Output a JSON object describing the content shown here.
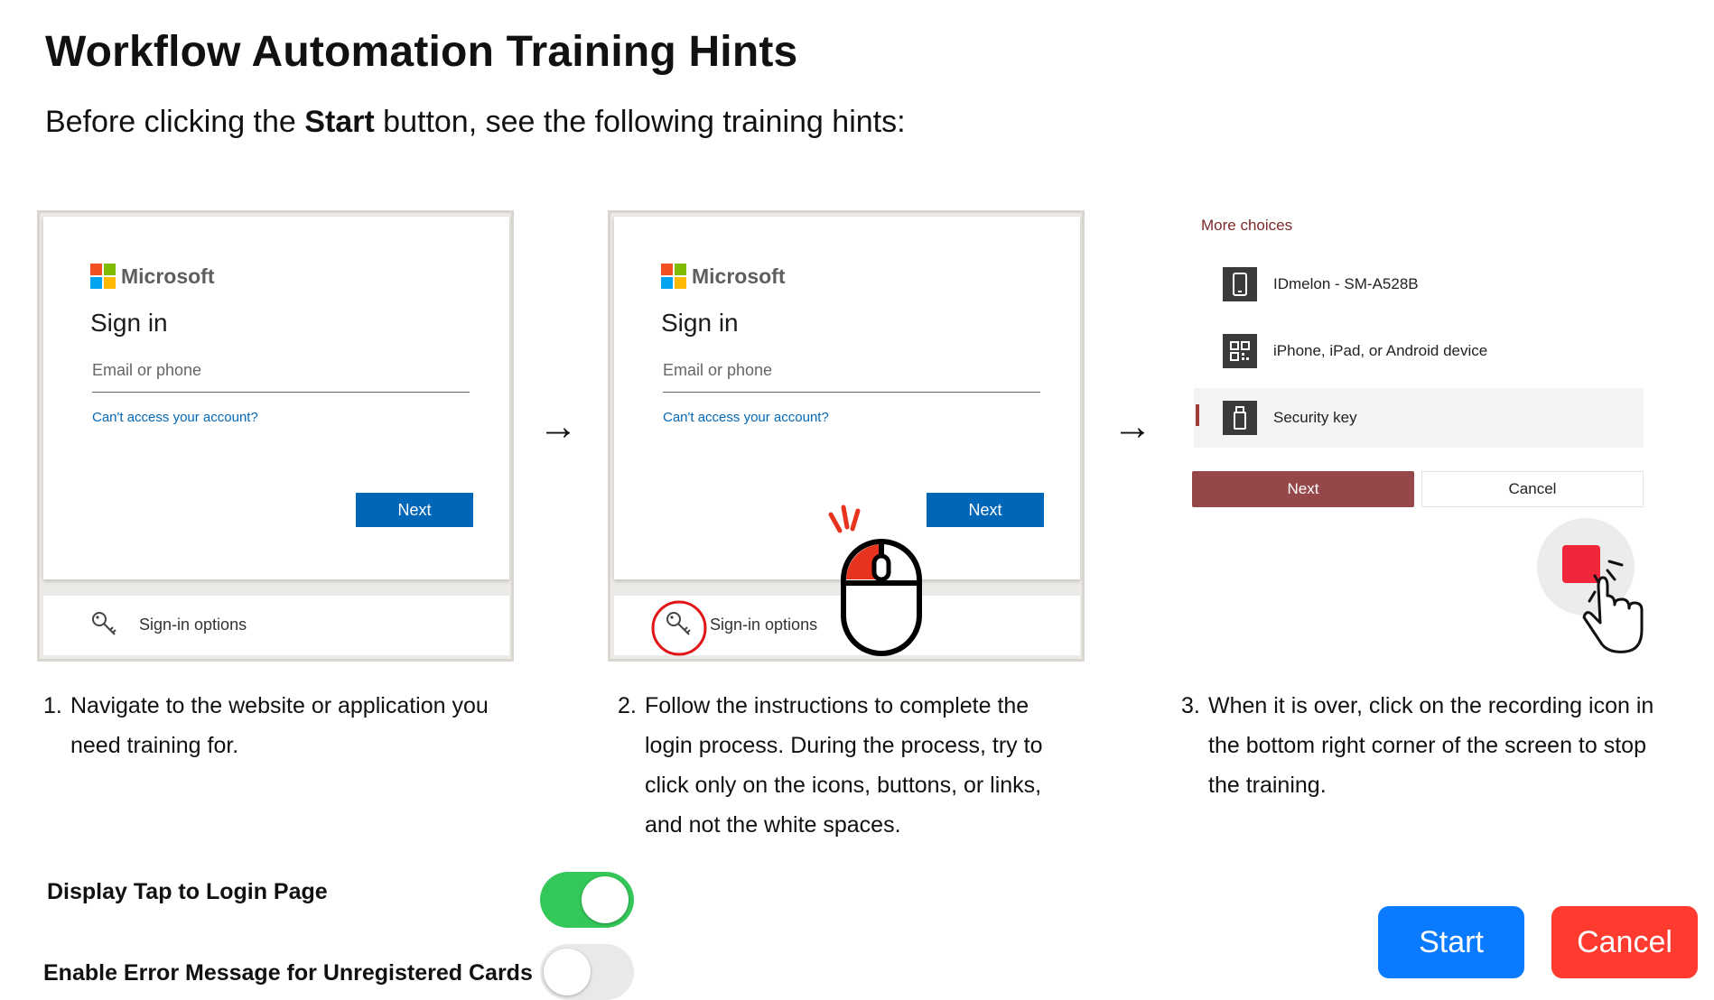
{
  "header": {
    "title": "Workflow Automation Training Hints",
    "subtitle_before": "Before clicking the ",
    "subtitle_bold": "Start",
    "subtitle_after": " button, see the following training hints:"
  },
  "signin_card": {
    "brand": "Microsoft",
    "heading": "Sign in",
    "email_placeholder": "Email or phone",
    "cant_access_link": "Can't access your account?",
    "next_label": "Next",
    "signin_options": "Sign-in options"
  },
  "more_choices": {
    "title": "More choices",
    "options": [
      {
        "label": "IDmelon - SM-A528B",
        "icon": "phone-icon"
      },
      {
        "label": "iPhone, iPad, or Android device",
        "icon": "qr-code-icon"
      },
      {
        "label": "Security key",
        "icon": "usb-key-icon"
      }
    ],
    "next_label": "Next",
    "cancel_label": "Cancel"
  },
  "steps": [
    {
      "num": "1.",
      "lines": [
        "Navigate to the website or application you",
        "need training for."
      ]
    },
    {
      "num": "2.",
      "lines": [
        "Follow the instructions to complete the",
        "login process. During the process, try to",
        "click only on the icons, buttons, or links,",
        "and not the white spaces."
      ]
    },
    {
      "num": "3.",
      "lines": [
        "When it is over, click on the recording icon in",
        "the bottom right corner of the screen to stop",
        "the training."
      ]
    }
  ],
  "settings": {
    "display_tap_label": "Display Tap to Login Page",
    "display_tap_enabled": true,
    "error_message_label": "Enable Error Message for Unregistered Cards",
    "error_message_enabled": false
  },
  "actions": {
    "start_label": "Start",
    "cancel_label": "Cancel"
  },
  "colors": {
    "start": "#0a7bff",
    "cancel": "#ff3b30",
    "toggle_on": "#34c759",
    "ms_blue": "#0067b8",
    "more_choices_next": "#96474a",
    "record": "#f0273a"
  }
}
